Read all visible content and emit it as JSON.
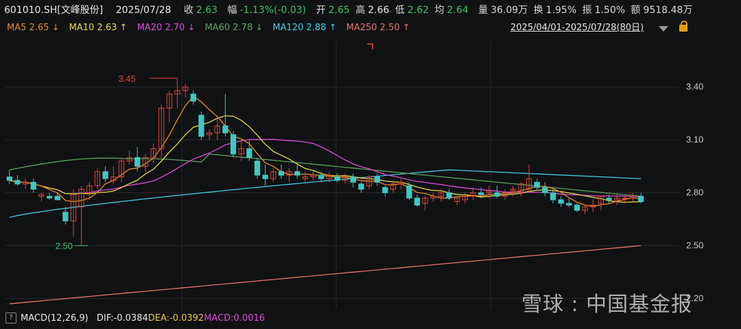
{
  "header": {
    "code": "601010.SH[文峰股份]",
    "date": "2025/07/28",
    "close_label": "收",
    "close": "2.63",
    "chg_label": "幅",
    "chg": "-1.13%(-0.03)",
    "open_label": "开",
    "open": "2.65",
    "high_label": "高",
    "high": "2.66",
    "low_label": "低",
    "low": "2.62",
    "avg_label": "均",
    "avg": "2.64",
    "vol_label": "量",
    "vol": "36.09万",
    "turn_label": "换",
    "turn": "1.95%",
    "amp_label": "振",
    "amp": "1.50%",
    "amt_label": "额",
    "amt": "9518.48万"
  },
  "ma_bar": {
    "ma5": "MA5 2.65",
    "ma5_arrow": "↓",
    "ma10": "MA10 2.63",
    "ma10_arrow": "↑",
    "ma20": "MA20 2.70",
    "ma20_arrow": "↓",
    "ma60": "MA60 2.78",
    "ma60_arrow": "↓",
    "ma120": "MA120 2.88",
    "ma120_arrow": "↑",
    "ma250": "MA250 2.50",
    "ma250_arrow": "↑",
    "range": "2025/04/01-2025/07/28(80日)"
  },
  "indicator": {
    "q": "?",
    "name": "MACD(12,26,9)",
    "dif": "DIF:-0.0384",
    "dea": "DEA:-0.0392",
    "macd": "MACD:0.0016"
  },
  "watermark": "雪球 : 中国基金报",
  "colors": {
    "up": "#e0453c",
    "down": "#3fc8c0",
    "ma5": "#e88a2e",
    "ma10": "#e6d84a",
    "ma20": "#d94ed6",
    "ma60": "#5aa35a",
    "ma120": "#48c8e0",
    "ma250": "#e2756a",
    "price_green": "#3fbf5f"
  },
  "chart_data": {
    "type": "candlestick",
    "yticks": [
      "3.40",
      "3.10",
      "2.80",
      "2.50",
      "2.20"
    ],
    "ylim": [
      2.14,
      3.66
    ],
    "annotations": {
      "high": "3.45",
      "low": "2.50"
    },
    "candles": [
      [
        2.89,
        2.93,
        2.85,
        2.87
      ],
      [
        2.87,
        2.9,
        2.84,
        2.85
      ],
      [
        2.85,
        2.88,
        2.82,
        2.86
      ],
      [
        2.86,
        2.88,
        2.8,
        2.82
      ],
      [
        2.78,
        2.8,
        2.75,
        2.79
      ],
      [
        2.78,
        2.8,
        2.76,
        2.77
      ],
      [
        2.78,
        2.8,
        2.76,
        2.76
      ],
      [
        2.69,
        2.72,
        2.62,
        2.64
      ],
      [
        2.64,
        2.82,
        2.55,
        2.79
      ],
      [
        2.72,
        2.84,
        2.5,
        2.82
      ],
      [
        2.8,
        2.86,
        2.76,
        2.84
      ],
      [
        2.84,
        2.94,
        2.82,
        2.92
      ],
      [
        2.92,
        2.95,
        2.86,
        2.88
      ],
      [
        2.87,
        2.95,
        2.85,
        2.89
      ],
      [
        2.89,
        3.0,
        2.86,
        2.98
      ],
      [
        2.98,
        3.04,
        2.96,
        3.0
      ],
      [
        3.0,
        3.06,
        2.92,
        2.95
      ],
      [
        2.95,
        3.02,
        2.92,
        3.0
      ],
      [
        3.0,
        3.08,
        2.97,
        3.05
      ],
      [
        3.05,
        3.3,
        3.0,
        3.28
      ],
      [
        3.28,
        3.38,
        3.2,
        3.36
      ],
      [
        3.36,
        3.45,
        3.28,
        3.38
      ],
      [
        3.38,
        3.42,
        3.34,
        3.4
      ],
      [
        3.36,
        3.38,
        3.3,
        3.32
      ],
      [
        3.24,
        3.26,
        3.1,
        3.12
      ],
      [
        3.13,
        3.16,
        3.1,
        3.14
      ],
      [
        3.14,
        3.22,
        3.1,
        3.18
      ],
      [
        3.18,
        3.36,
        3.12,
        3.14
      ],
      [
        3.13,
        3.15,
        3.0,
        3.02
      ],
      [
        3.02,
        3.1,
        2.98,
        3.05
      ],
      [
        3.05,
        3.1,
        2.98,
        3.0
      ],
      [
        2.98,
        3.0,
        2.88,
        2.9
      ],
      [
        2.9,
        2.96,
        2.84,
        2.88
      ],
      [
        2.88,
        2.94,
        2.86,
        2.92
      ],
      [
        2.92,
        2.96,
        2.88,
        2.9
      ],
      [
        2.9,
        2.94,
        2.86,
        2.92
      ],
      [
        2.92,
        2.96,
        2.88,
        2.9
      ],
      [
        2.88,
        2.92,
        2.86,
        2.89
      ],
      [
        2.89,
        2.92,
        2.87,
        2.9
      ],
      [
        2.9,
        2.92,
        2.86,
        2.88
      ],
      [
        2.88,
        2.92,
        2.86,
        2.9
      ],
      [
        2.89,
        2.91,
        2.86,
        2.87
      ],
      [
        2.87,
        2.91,
        2.85,
        2.89
      ],
      [
        2.89,
        2.91,
        2.83,
        2.86
      ],
      [
        2.85,
        2.86,
        2.8,
        2.82
      ],
      [
        2.84,
        2.9,
        2.82,
        2.89
      ],
      [
        2.89,
        2.91,
        2.84,
        2.86
      ],
      [
        2.83,
        2.84,
        2.78,
        2.8
      ],
      [
        2.82,
        2.87,
        2.8,
        2.85
      ],
      [
        2.85,
        2.88,
        2.82,
        2.86
      ],
      [
        2.84,
        2.86,
        2.76,
        2.77
      ],
      [
        2.77,
        2.79,
        2.72,
        2.73
      ],
      [
        2.74,
        2.78,
        2.7,
        2.77
      ],
      [
        2.77,
        2.8,
        2.75,
        2.78
      ],
      [
        2.78,
        2.82,
        2.75,
        2.8
      ],
      [
        2.8,
        2.82,
        2.76,
        2.77
      ],
      [
        2.75,
        2.78,
        2.73,
        2.77
      ],
      [
        2.76,
        2.8,
        2.74,
        2.78
      ],
      [
        2.78,
        2.83,
        2.76,
        2.8
      ],
      [
        2.8,
        2.83,
        2.77,
        2.79
      ],
      [
        2.8,
        2.84,
        2.77,
        2.81
      ],
      [
        2.8,
        2.84,
        2.77,
        2.78
      ],
      [
        2.78,
        2.82,
        2.76,
        2.8
      ],
      [
        2.81,
        2.84,
        2.78,
        2.82
      ],
      [
        2.8,
        2.86,
        2.78,
        2.85
      ],
      [
        2.82,
        2.96,
        2.8,
        2.88
      ],
      [
        2.86,
        2.88,
        2.81,
        2.83
      ],
      [
        2.83,
        2.86,
        2.78,
        2.8
      ],
      [
        2.8,
        2.82,
        2.74,
        2.76
      ],
      [
        2.76,
        2.78,
        2.72,
        2.74
      ],
      [
        2.74,
        2.77,
        2.72,
        2.73
      ],
      [
        2.73,
        2.74,
        2.69,
        2.7
      ],
      [
        2.7,
        2.73,
        2.68,
        2.72
      ],
      [
        2.72,
        2.76,
        2.69,
        2.73
      ],
      [
        2.74,
        2.78,
        2.7,
        2.78
      ],
      [
        2.77,
        2.79,
        2.74,
        2.76
      ],
      [
        2.76,
        2.8,
        2.73,
        2.77
      ],
      [
        2.77,
        2.79,
        2.74,
        2.77
      ],
      [
        2.77,
        2.8,
        2.75,
        2.78
      ],
      [
        2.78,
        2.8,
        2.74,
        2.75
      ]
    ]
  }
}
